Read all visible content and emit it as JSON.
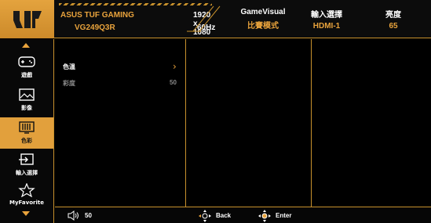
{
  "header": {
    "model_name": "ASUS TUF GAMING",
    "model_code": "VG249Q3R",
    "resolution": "1920 x 1080",
    "refresh_rate": "60Hz",
    "columns": [
      {
        "title": "GameVisual",
        "value": "比賽模式"
      },
      {
        "title": "輸入選擇",
        "value": "HDMI-1"
      },
      {
        "title": "亮度",
        "value": "65"
      }
    ]
  },
  "sidebar": {
    "items": [
      {
        "label": "遊戲",
        "icon": "gamepad-icon",
        "active": false
      },
      {
        "label": "影像",
        "icon": "image-icon",
        "active": false
      },
      {
        "label": "色彩",
        "icon": "color-icon",
        "active": true
      },
      {
        "label": "輸入選擇",
        "icon": "input-select-icon",
        "active": false
      },
      {
        "label": "MyFavorite",
        "icon": "star-icon",
        "active": false
      }
    ]
  },
  "menu": {
    "items": [
      {
        "label": "色溫",
        "value": "",
        "selected": true
      },
      {
        "label": "彩度",
        "value": "50",
        "selected": false
      }
    ]
  },
  "footer": {
    "volume": "50",
    "back_label": "Back",
    "enter_label": "Enter"
  },
  "colors": {
    "accent": "#e9a33c",
    "active_bg": "#e2a03c",
    "border": "#c8912c",
    "background": "#000000"
  }
}
